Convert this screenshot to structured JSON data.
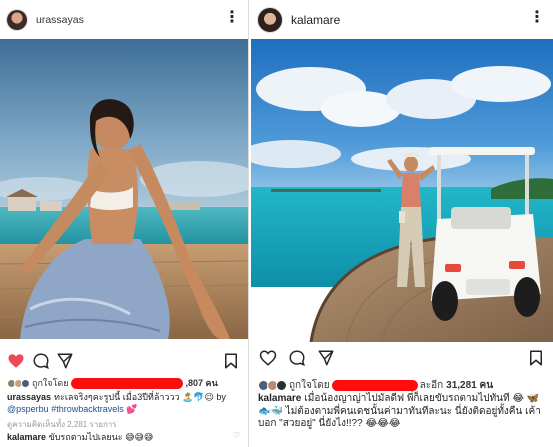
{
  "left_post": {
    "username": "urassayas",
    "more_icon": "more-vertical-icon",
    "like_state": "liked",
    "colors": {
      "liked": "#ed4956",
      "link": "#1e4f91"
    },
    "likes": {
      "prefix": "ถูกใจโดย",
      "suffix": ",807 คน"
    },
    "caption": {
      "username": "urassayas",
      "text": "ทะเลจริงๆคะรูปนี้ เมื่อ3ปีที่ล้าววว 🏝️🐬😉 by",
      "mention": "@psperbu",
      "hashtag": "#throwbacktravels",
      "emoji": "💕"
    },
    "view_comments": "ดูความคิดเห็นทั้ง 2,281 รายการ",
    "comment": {
      "username": "kalamare",
      "text": "ขับรถตามไปเลยนะ 😅😅😅"
    }
  },
  "right_post": {
    "username": "kalamare",
    "more_icon": "more-vertical-icon",
    "like_state": "not-liked",
    "likes": {
      "prefix": "ถูกใจโดย",
      "suffix": "ละอีก",
      "count": "31,281 คน"
    },
    "caption": {
      "username": "kalamare",
      "text": "เมื่อน้องญาญ่าไปมัลดีฟ พี่ก็เลยขับรถตามไปทันที 😂 🦋🐟🐳 ไม่ต้องตามพี่คนเดชนั้นค่ามาทันทีละนะ นี่ยังติดอยู่ทั้งคืน เค้าบอก \"สวยอยู่\" นี่ยังไง!!?? 😂😂😂"
    }
  }
}
